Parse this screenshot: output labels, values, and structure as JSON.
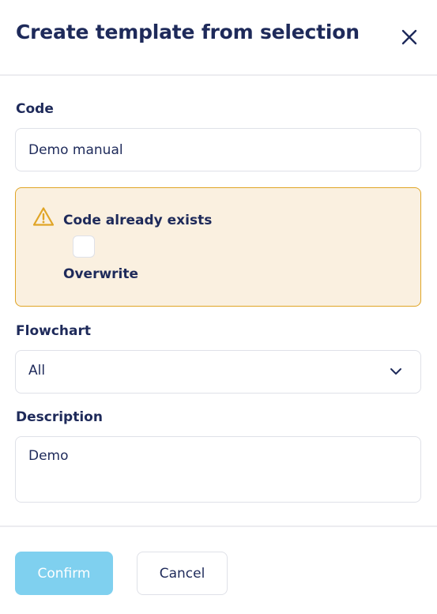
{
  "dialog": {
    "title": "Create template from selection"
  },
  "code": {
    "label": "Code",
    "value": "Demo manual"
  },
  "warning": {
    "title": "Code already exists",
    "checkbox_label": "Overwrite",
    "checked": false
  },
  "flowchart": {
    "label": "Flowchart",
    "selected": "All"
  },
  "description": {
    "label": "Description",
    "value": "Demo"
  },
  "footer": {
    "confirm_label": "Confirm",
    "confirm_disabled": true,
    "cancel_label": "Cancel"
  },
  "colors": {
    "text": "#1e2a5a",
    "warning_bg": "#faf0e0",
    "warning_border": "#e0a526",
    "confirm_bg": "#7fd0ef"
  },
  "icons": {
    "close": "close-icon",
    "warning": "warning-triangle-icon",
    "dropdown": "chevron-down-icon"
  }
}
